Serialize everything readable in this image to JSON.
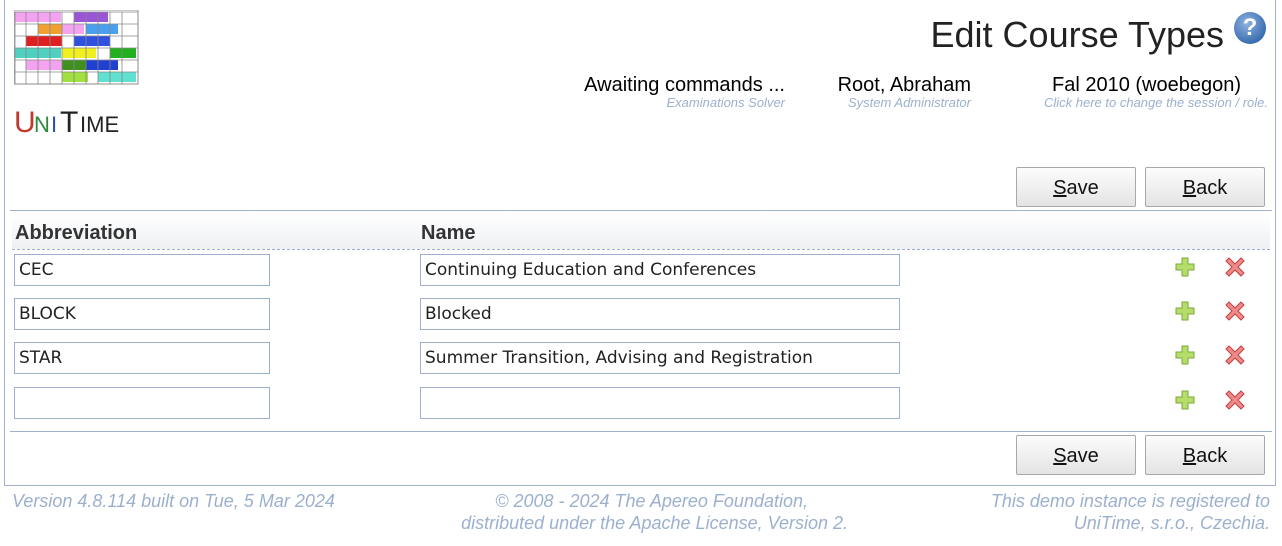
{
  "header": {
    "title": "Edit Course Types",
    "help_icon": "question-circle-icon",
    "solver": {
      "main": "Awaiting commands ...",
      "sub": "Examinations Solver"
    },
    "user": {
      "main": "Root, Abraham",
      "sub": "System Administrator"
    },
    "session": {
      "main": "Fal 2010 (woebegon)",
      "sub": "Click here to change the session / role."
    }
  },
  "logo": {
    "text": "UniTime"
  },
  "buttons": {
    "save": {
      "label": "Save",
      "accel": "S",
      "rest": "ave"
    },
    "back": {
      "label": "Back",
      "accel": "B",
      "rest": "ack"
    }
  },
  "table": {
    "columns": [
      "Abbreviation",
      "Name"
    ],
    "rows": [
      {
        "abbreviation": "CEC",
        "name": "Continuing Education and Conferences"
      },
      {
        "abbreviation": "BLOCK",
        "name": "Blocked"
      },
      {
        "abbreviation": "STAR",
        "name": "Summer Transition, Advising and Registration"
      },
      {
        "abbreviation": "",
        "name": ""
      }
    ],
    "row_icons": [
      "plus-icon",
      "delete-x-icon"
    ]
  },
  "footer": {
    "version": "Version 4.8.114 built on Tue, 5 Mar 2024",
    "copyright_line1": "© 2008 - 2024 The Apereo Foundation,",
    "copyright_line2": "distributed under the Apache License, Version 2.",
    "registration_line1": "This demo instance is registered to",
    "registration_line2": "UniTime, s.r.o., Czechia."
  },
  "colors": {
    "accent": "#9cb0ce",
    "plus": "#8cc63f",
    "delete": "#e05a5a"
  }
}
